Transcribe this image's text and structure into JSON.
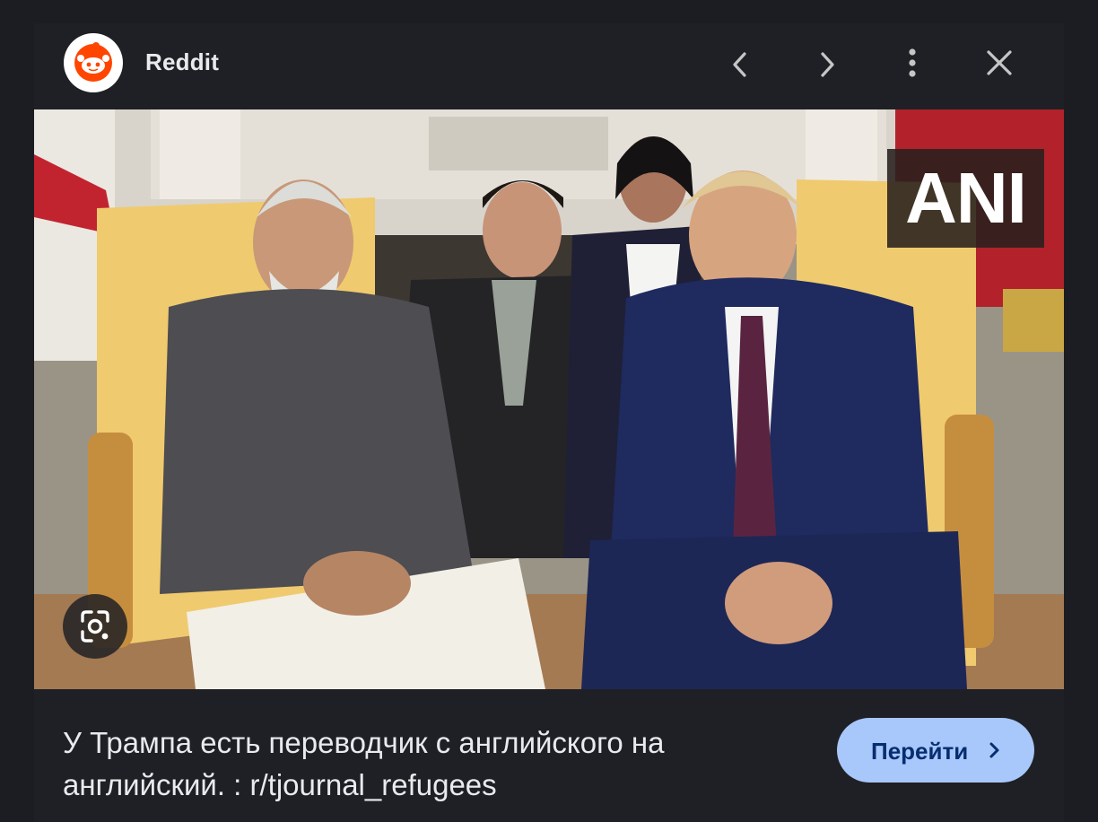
{
  "header": {
    "source_name": "Reddit",
    "source_icon": "reddit-logo-icon",
    "prev_icon": "chevron-left-icon",
    "next_icon": "chevron-right-icon",
    "more_icon": "more-vert-icon",
    "close_icon": "close-icon"
  },
  "image": {
    "watermark": "ANI",
    "lens_icon": "google-lens-icon"
  },
  "caption": {
    "line1": "У Трампа есть переводчик с английского на",
    "line2": "английский. : r/tjournal_refugees"
  },
  "visit_button": {
    "label": "Перейти",
    "icon": "chevron-right-icon"
  },
  "colors": {
    "background": "#1c1d22",
    "accent_button": "#a8c7fa",
    "button_text": "#062e6f",
    "reddit_orange": "#ff4500",
    "text": "#e8eaed"
  }
}
